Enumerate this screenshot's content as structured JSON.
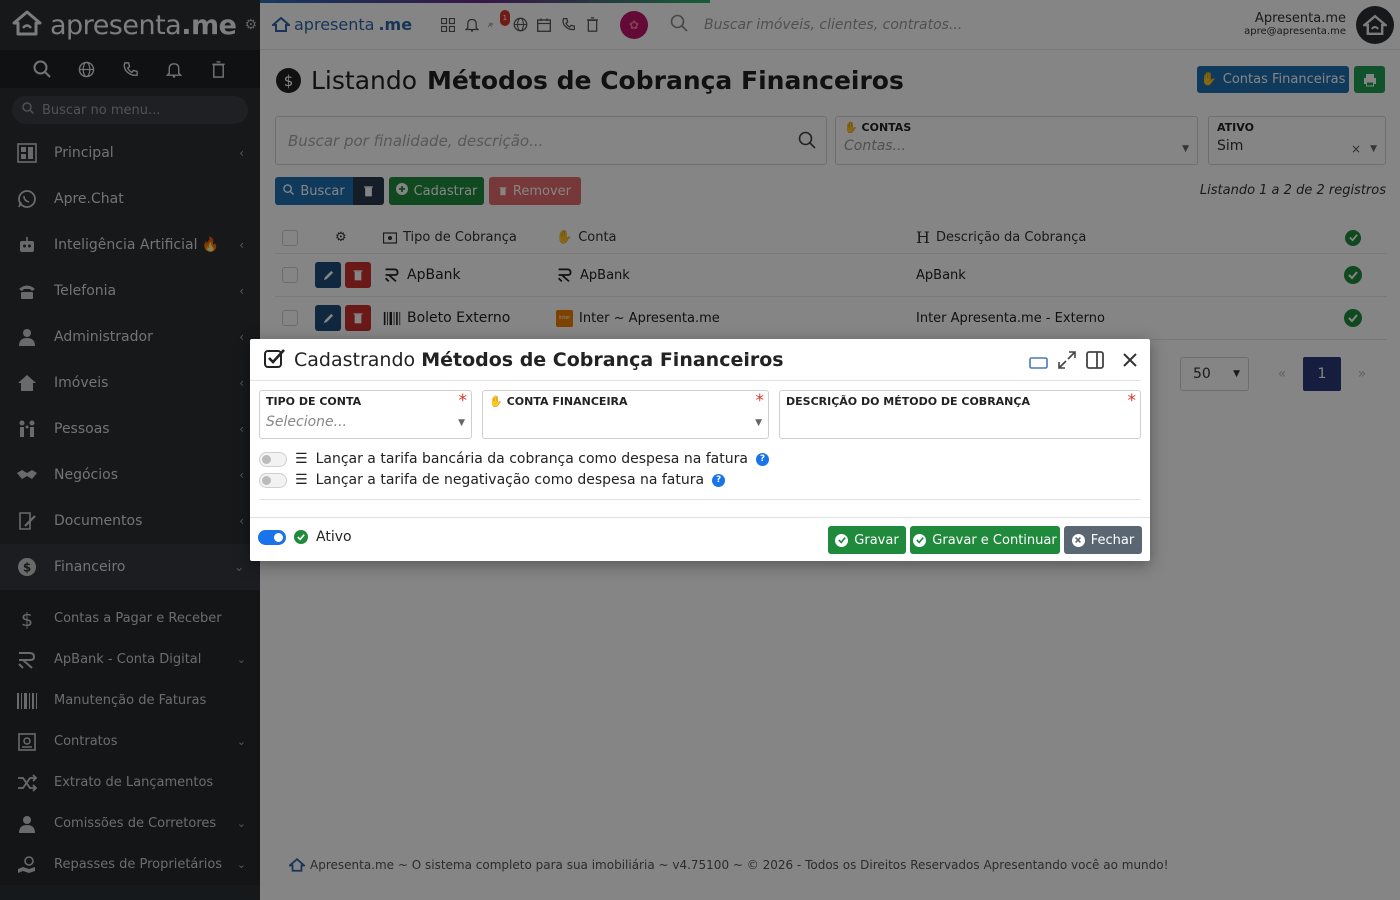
{
  "sidebar": {
    "brand_light": "apresenta",
    "brand_bold": ".me",
    "search_placeholder": "Buscar no menu...",
    "items": [
      {
        "label": "Principal",
        "icon": "dashboard-icon"
      },
      {
        "label": "Apre.Chat",
        "icon": "whatsapp-icon"
      },
      {
        "label": "Inteligência Artificial 🔥",
        "icon": "robot-icon"
      },
      {
        "label": "Telefonia",
        "icon": "phone-icon"
      },
      {
        "label": "Administrador",
        "icon": "user-tie-icon"
      },
      {
        "label": "Imóveis",
        "icon": "house-icon"
      },
      {
        "label": "Pessoas",
        "icon": "people-icon"
      },
      {
        "label": "Negócios",
        "icon": "handshake-icon"
      },
      {
        "label": "Documentos",
        "icon": "document-sign-icon"
      },
      {
        "label": "Financeiro",
        "icon": "dollar-circle-icon"
      }
    ],
    "subitems": [
      {
        "label": "Contas a Pagar e Receber",
        "icon": "dollar-icon"
      },
      {
        "label": "ApBank - Conta Digital",
        "icon": "apbank-icon"
      },
      {
        "label": "Manutenção de Faturas",
        "icon": "barcode-icon"
      },
      {
        "label": "Contratos",
        "icon": "contract-icon"
      },
      {
        "label": "Extrato de Lançamentos",
        "icon": "shuffle-icon"
      },
      {
        "label": "Comissões de Corretores",
        "icon": "user-tie-icon"
      },
      {
        "label": "Repasses de Proprietários",
        "icon": "hand-money-icon"
      }
    ]
  },
  "topbar": {
    "logo_light": "apresenta",
    "logo_bold": ".me",
    "badge_count": "1",
    "search_placeholder": "Buscar imóveis, clientes, contratos...",
    "user_name": "Apresenta.me",
    "user_email": "apre@apresenta.me"
  },
  "page": {
    "title_light": "Listando",
    "title_bold": "Métodos de Cobrança Financeiros",
    "contas_button": "Contas Financeiras",
    "search_placeholder": "Buscar por finalidade, descrição...",
    "filter_contas_label": "CONTAS",
    "filter_contas_placeholder": "Contas...",
    "filter_ativo_label": "ATIVO",
    "filter_ativo_value": "Sim",
    "btn_buscar": "Buscar",
    "btn_cadastrar": "Cadastrar",
    "btn_remover": "Remover",
    "listing_info": "Listando 1 a 2 de 2 registros",
    "per_page": "50",
    "current_page": "1"
  },
  "table": {
    "headers": {
      "tipo": "Tipo de Cobrança",
      "conta": "Conta",
      "descricao": "Descrição da Cobrança"
    },
    "rows": [
      {
        "tipo": "ApBank",
        "conta": "ApBank",
        "descricao": "ApBank"
      },
      {
        "tipo": "Boleto Externo",
        "conta": "Inter ~ Apresenta.me",
        "descricao": "Inter Apresenta.me - Externo"
      }
    ]
  },
  "footer": {
    "text": "Apresenta.me ~ O sistema completo para sua imobiliária ~ v4.75100 ~ © 2026 - Todos os Direitos Reservados Apresentando você ao mundo!"
  },
  "modal": {
    "title_light": "Cadastrando",
    "title_bold": "Métodos de Cobrança Financeiros",
    "field_tipo_label": "TIPO DE CONTA",
    "field_tipo_placeholder": "Selecione...",
    "field_conta_label": "CONTA FINANCEIRA",
    "field_descricao_label": "DESCRIÇÃO DO MÉTODO DE COBRANÇA",
    "toggle_tarifa_bancaria": "Lançar a tarifa bancária da cobrança como despesa na fatura",
    "toggle_tarifa_negativacao": "Lançar a tarifa de negativação como despesa na fatura",
    "ativo_label": "Ativo",
    "btn_gravar": "Gravar",
    "btn_gravar_continuar": "Gravar e Continuar",
    "btn_fechar": "Fechar"
  },
  "colors": {
    "primary_blue": "#1f6fb0",
    "success_green": "#1f8a3c",
    "danger_red": "#c9302c",
    "sidebar_bg": "#2b2f33",
    "toggle_on": "#1a73e8"
  }
}
